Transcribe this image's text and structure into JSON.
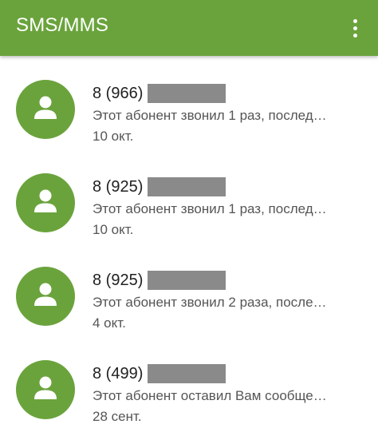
{
  "app_bar": {
    "title": "SMS/MMS",
    "color": "#6aa33c",
    "menu_icon": "more-vert-icon"
  },
  "threads": [
    {
      "sender": "8 (966)",
      "preview": "Этот абонент звонил 1 раз, послед…",
      "date": "10 окт."
    },
    {
      "sender": "8 (925)",
      "preview": "Этот абонент звонил 1 раз, послед…",
      "date": "10 окт."
    },
    {
      "sender": "8 (925)",
      "preview": "Этот абонент звонил 2 раза, после…",
      "date": "4 окт."
    },
    {
      "sender": "8 (499)",
      "preview": "Этот абонент оставил Вам сообще…",
      "date": "28 сент."
    }
  ],
  "avatar_icon": "person-icon"
}
